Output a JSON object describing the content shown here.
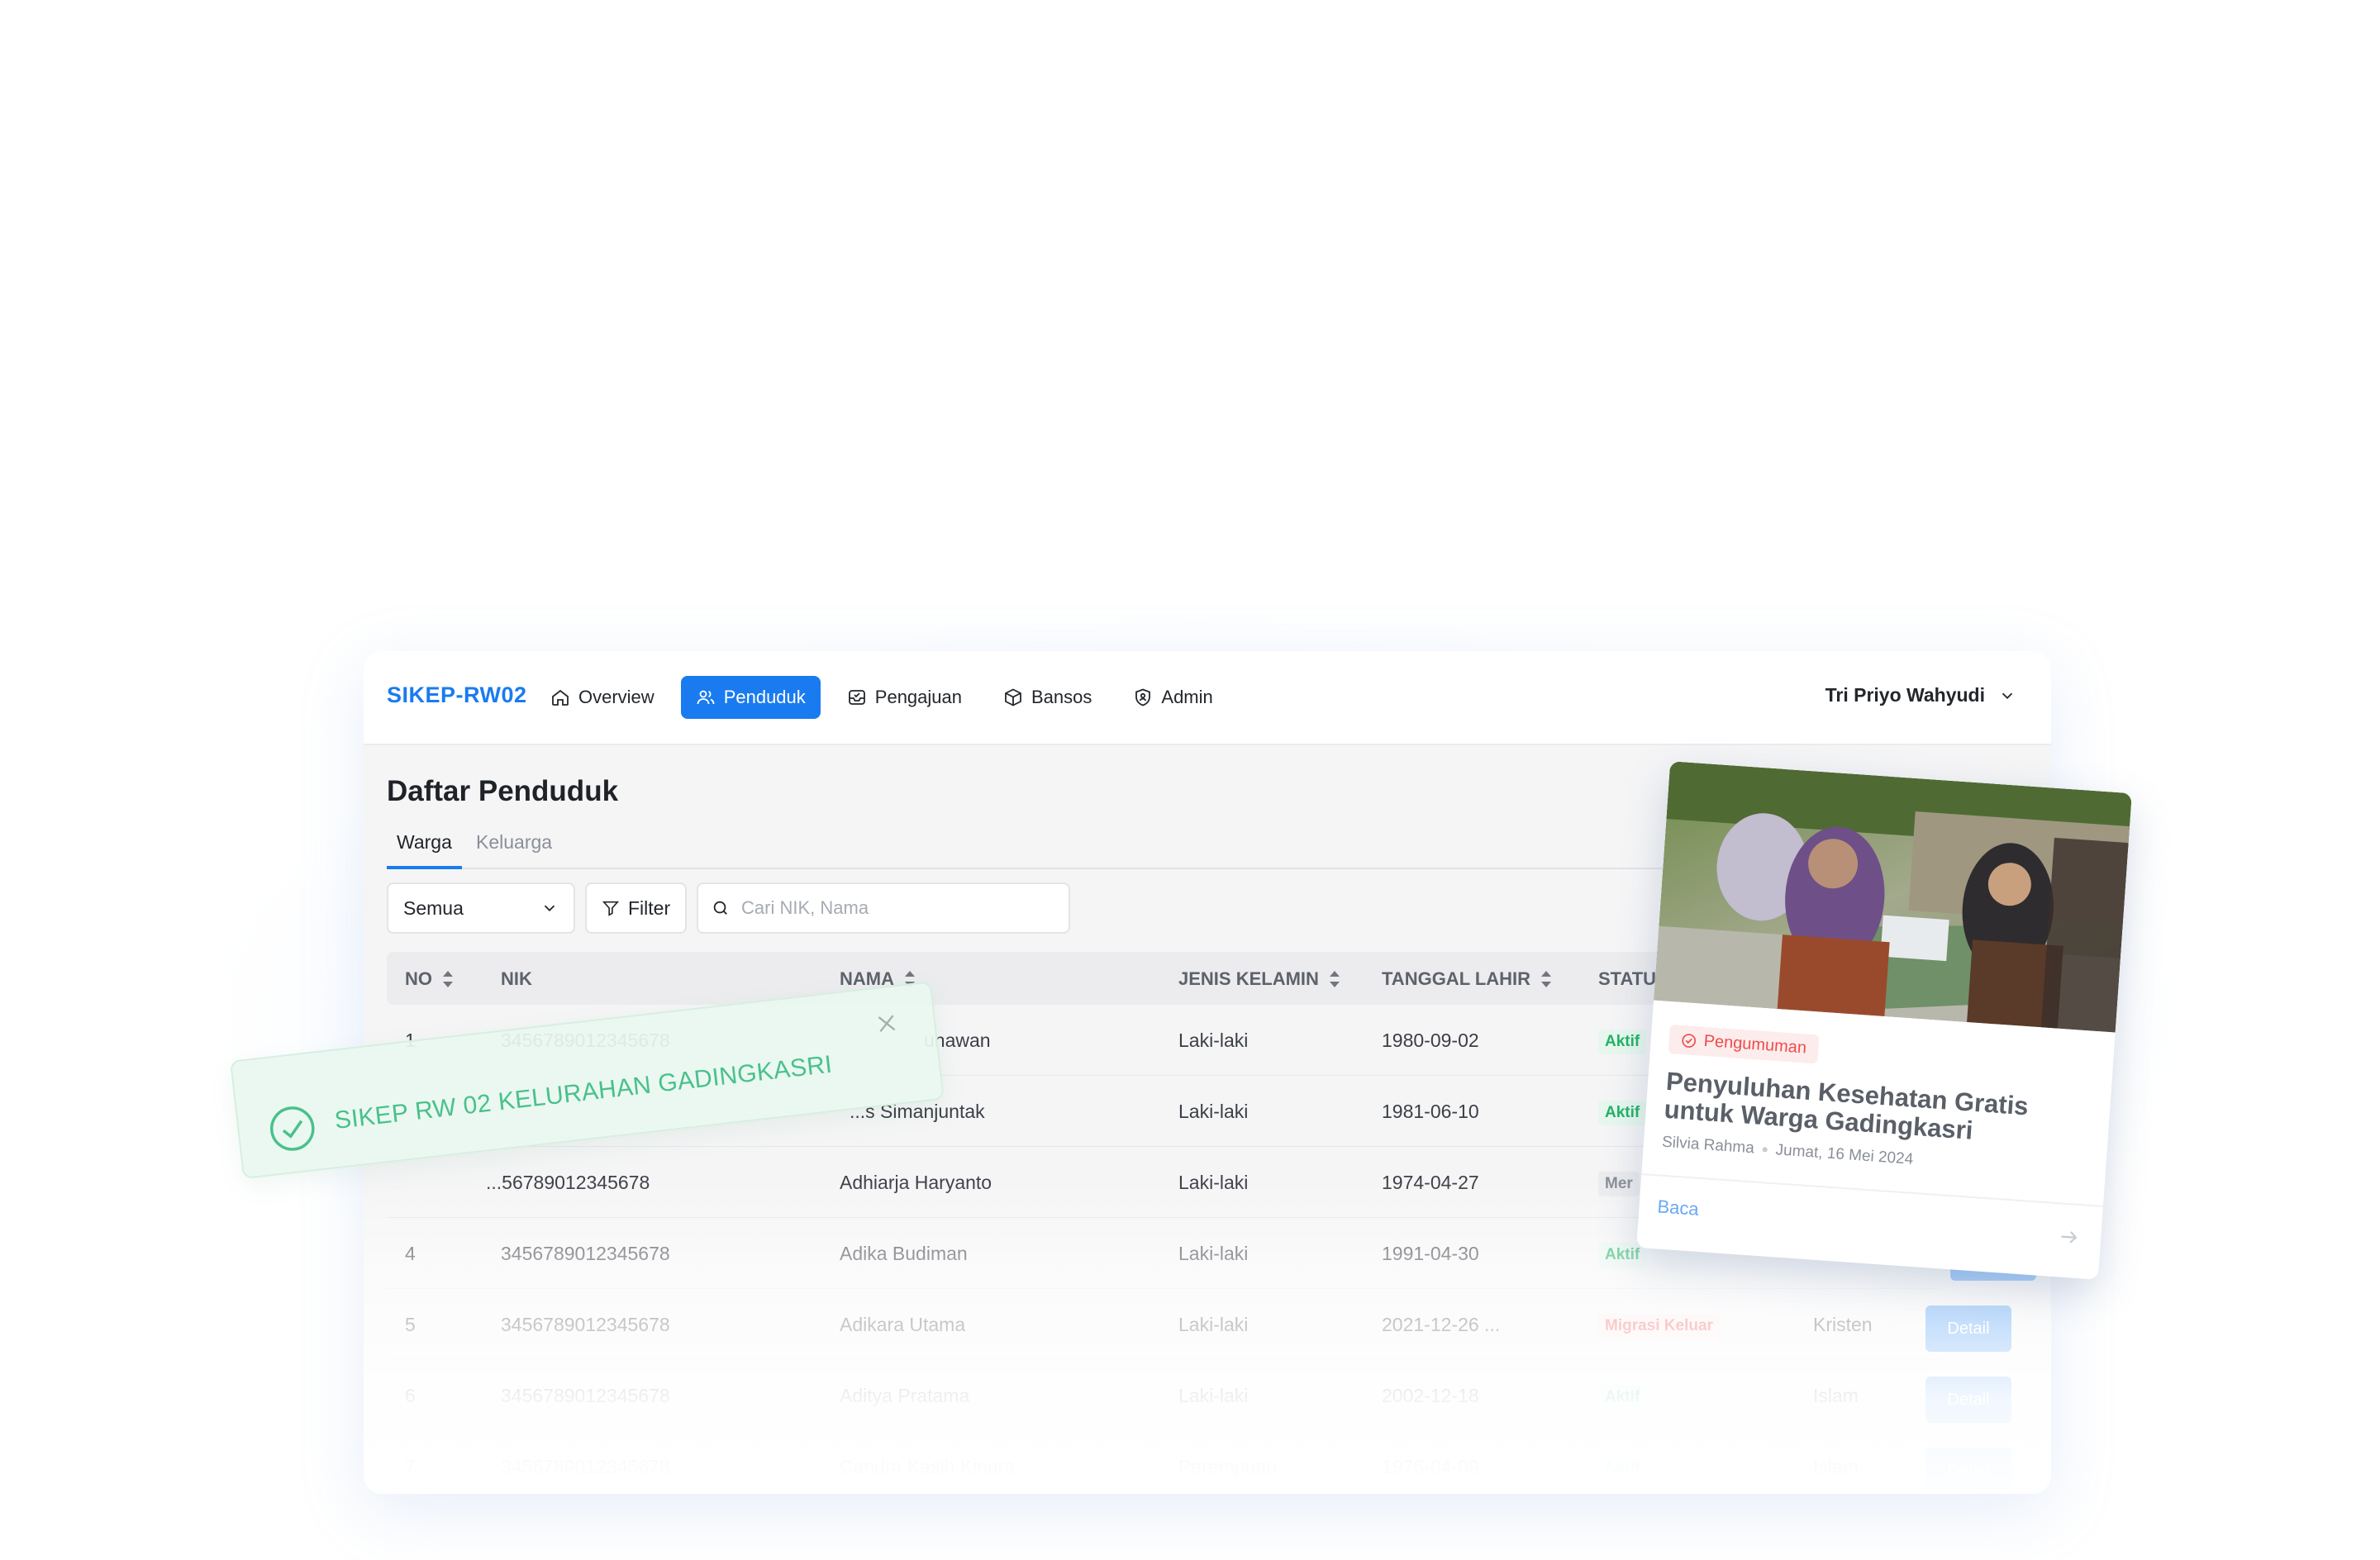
{
  "app": {
    "brand": "SIKEP-RW02",
    "nav": [
      {
        "label": "Overview",
        "icon": "home-icon"
      },
      {
        "label": "Penduduk",
        "icon": "users-icon",
        "active": true
      },
      {
        "label": "Pengajuan",
        "icon": "inbox-icon"
      },
      {
        "label": "Bansos",
        "icon": "box-icon"
      },
      {
        "label": "Admin",
        "icon": "shield-icon"
      }
    ],
    "user": "Tri Priyo Wahyudi"
  },
  "page": {
    "title": "Daftar Penduduk",
    "tabs": [
      "Warga",
      "Keluarga"
    ],
    "select_value": "Semua",
    "filter_label": "Filter",
    "search_placeholder": "Cari NIK, Nama"
  },
  "table": {
    "columns": [
      "NO",
      "NIK",
      "NAMA",
      "JENIS KELAMIN",
      "TANGGAL LAHIR",
      "STATU"
    ],
    "rows": [
      {
        "no": "1",
        "nik": "3456789012345678",
        "nama": "unawan",
        "jk": "Laki-laki",
        "tgl": "1980-09-02",
        "status": "Aktif",
        "status_type": "aktif",
        "agama": "",
        "detail": ""
      },
      {
        "no": "",
        "nik": "",
        "nama": "...s Simanjuntak",
        "jk": "Laki-laki",
        "tgl": "1981-06-10",
        "status": "Aktif",
        "status_type": "aktif",
        "agama": "",
        "detail": ""
      },
      {
        "no": "",
        "nik": "...56789012345678",
        "nama": "Adhiarja Haryanto",
        "jk": "Laki-laki",
        "tgl": "1974-04-27",
        "status": "Mer",
        "status_type": "meninggal",
        "agama": "",
        "detail": ""
      },
      {
        "no": "4",
        "nik": "3456789012345678",
        "nama": "Adika Budiman",
        "jk": "Laki-laki",
        "tgl": "1991-04-30",
        "status": "Aktif",
        "status_type": "aktif",
        "agama": "",
        "detail": ""
      },
      {
        "no": "5",
        "nik": "3456789012345678",
        "nama": "Adikara Utama",
        "jk": "Laki-laki",
        "tgl": "2021-12-26 ...",
        "status": "Migrasi Keluar",
        "status_type": "migrasi",
        "agama": "Kristen",
        "detail": "Detail"
      },
      {
        "no": "6",
        "nik": "3456789012345678",
        "nama": "Aditya Pratama",
        "jk": "Laki-laki",
        "tgl": "2002-12-18",
        "status": "Aktif",
        "status_type": "aktif",
        "agama": "Islam",
        "detail": "Detail"
      },
      {
        "no": "7",
        "nik": "3456789012345678",
        "nama": "Candra Kasih Kinara",
        "jk": "Perempuan",
        "tgl": "1976-04-09",
        "status": "Aktif",
        "status_type": "aktif",
        "agama": "Islam",
        "detail": "Detail"
      }
    ]
  },
  "toast": {
    "message": "SIKEP RW 02 KELURAHAN GADINGKASRI"
  },
  "announcement": {
    "tag": "Pengumuman",
    "title": "Penyuluhan Kesehatan Gratis untuk Warga Gadingkasri",
    "author": "Silvia Rahma",
    "date": "Jumat, 16 Mei 2024",
    "read_label": "Baca"
  },
  "colors": {
    "primary": "#1a7bf0",
    "success": "#22b365",
    "danger": "#ef4b4b",
    "toast_text": "#49c18a"
  }
}
